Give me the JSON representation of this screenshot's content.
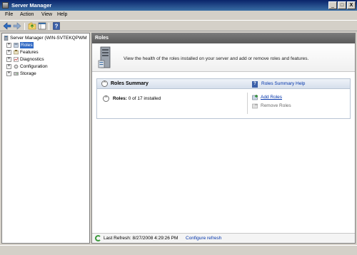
{
  "window": {
    "title": "Server Manager",
    "controls": [
      "_",
      "□",
      "X"
    ]
  },
  "menu": [
    "File",
    "Action",
    "View",
    "Help"
  ],
  "toolbar": {
    "buttons": [
      "back-arrow-icon",
      "forward-arrow-icon",
      "up-folder-icon",
      "show-hide-tree-icon",
      "help-icon"
    ]
  },
  "tree": {
    "root": "Server Manager (WIN-SVTEKQPWM",
    "items": [
      {
        "label": "Roles",
        "expander": "+",
        "selected": true
      },
      {
        "label": "Features",
        "expander": "+"
      },
      {
        "label": "Diagnostics",
        "expander": "+"
      },
      {
        "label": "Configuration",
        "expander": "+"
      },
      {
        "label": "Storage",
        "expander": "+"
      }
    ]
  },
  "content": {
    "header": "Roles",
    "banner_text": "View the health of the roles installed on your server and add or remove roles and features.",
    "summary": {
      "title": "Roles Summary",
      "collapse_glyph": "^",
      "help_link": "Roles Summary Help",
      "roles_label": "Roles:",
      "roles_status": "0 of 17 installed",
      "actions": [
        {
          "label": "Add Roles",
          "enabled": true
        },
        {
          "label": "Remove Roles",
          "enabled": false
        }
      ]
    },
    "status": {
      "last_refresh": "Last Refresh: 8/27/2008 4:29:26 PM",
      "configure_link": "Configure refresh"
    }
  },
  "colors": {
    "titlebar": "#0a246a",
    "selection": "#316ac5",
    "link": "#0033aa",
    "header_gray": "#6a6a6a"
  }
}
